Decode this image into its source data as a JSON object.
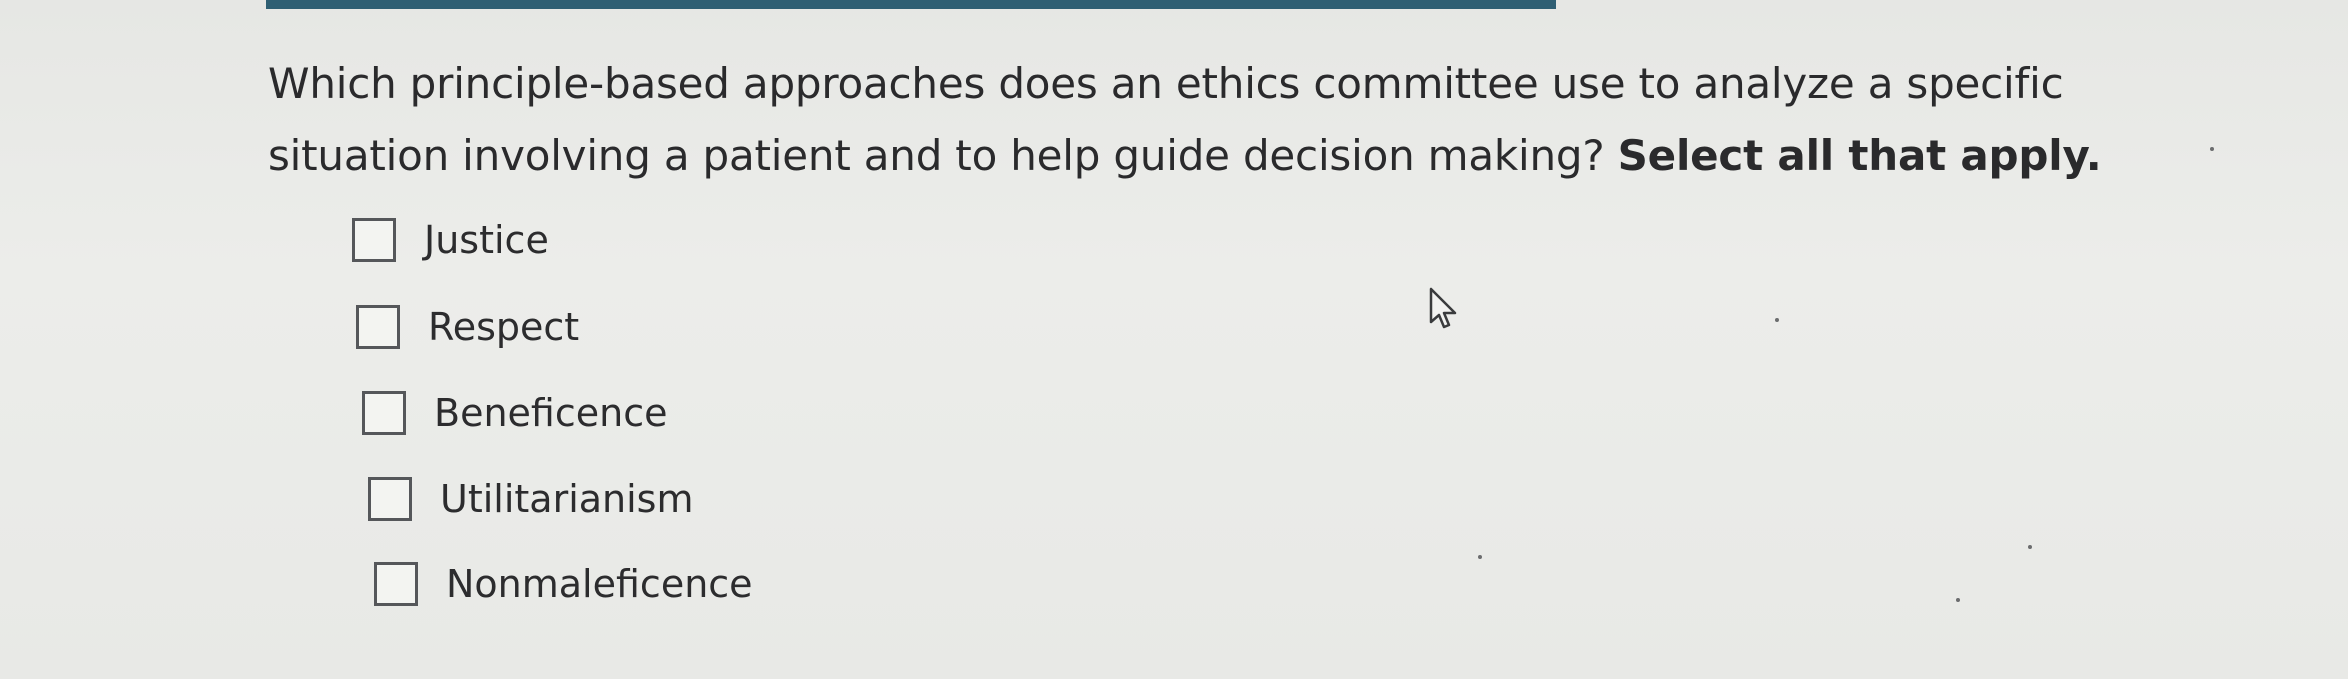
{
  "question": {
    "text": "Which principle-based approaches does an ethics committee use to analyze a specific situation involving a patient and to help guide decision making?",
    "instruction": "Select all that apply."
  },
  "options": [
    {
      "label": "Justice",
      "checked": false
    },
    {
      "label": "Respect",
      "checked": false
    },
    {
      "label": "Beneficence",
      "checked": false
    },
    {
      "label": "Utilitarianism",
      "checked": false
    },
    {
      "label": "Nonmaleficence",
      "checked": false
    }
  ],
  "colors": {
    "top_bar": "#2f5f73",
    "background": "#e9eae7",
    "text": "#2a2a2c"
  },
  "icons": {
    "cursor": "mouse-pointer-icon"
  }
}
